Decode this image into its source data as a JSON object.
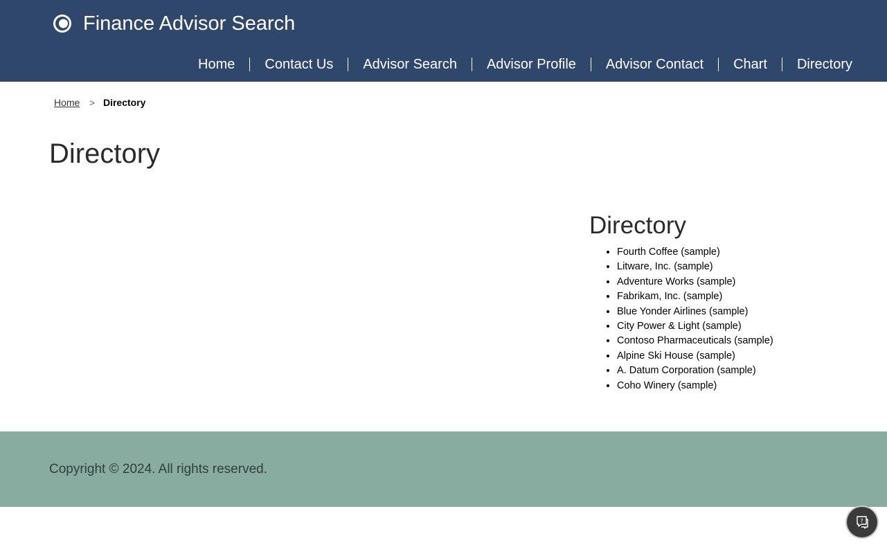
{
  "header": {
    "title": "Finance Advisor Search",
    "logo_icon": "ring-logo-icon",
    "colors": {
      "background": "#2e476b",
      "text": "#ffffff"
    }
  },
  "nav": {
    "items": [
      {
        "label": "Home"
      },
      {
        "label": "Contact Us"
      },
      {
        "label": "Advisor Search"
      },
      {
        "label": "Advisor Profile"
      },
      {
        "label": "Advisor Contact"
      },
      {
        "label": "Chart"
      },
      {
        "label": "Directory"
      }
    ]
  },
  "breadcrumb": {
    "home": "Home",
    "separator": ">",
    "current": "Directory"
  },
  "page": {
    "title": "Directory"
  },
  "directory": {
    "heading": "Directory",
    "items": [
      "Fourth Coffee (sample)",
      "Litware, Inc. (sample)",
      "Adventure Works (sample)",
      "Fabrikam, Inc. (sample)",
      "Blue Yonder Airlines (sample)",
      "City Power & Light (sample)",
      "Contoso Pharmaceuticals (sample)",
      "Alpine Ski House (sample)",
      "A. Datum Corporation (sample)",
      "Coho Winery (sample)"
    ]
  },
  "footer": {
    "text": "Copyright © 2024. All rights reserved.",
    "color": "#89aca1"
  },
  "help_button": {
    "icon": "chat-help-icon"
  }
}
